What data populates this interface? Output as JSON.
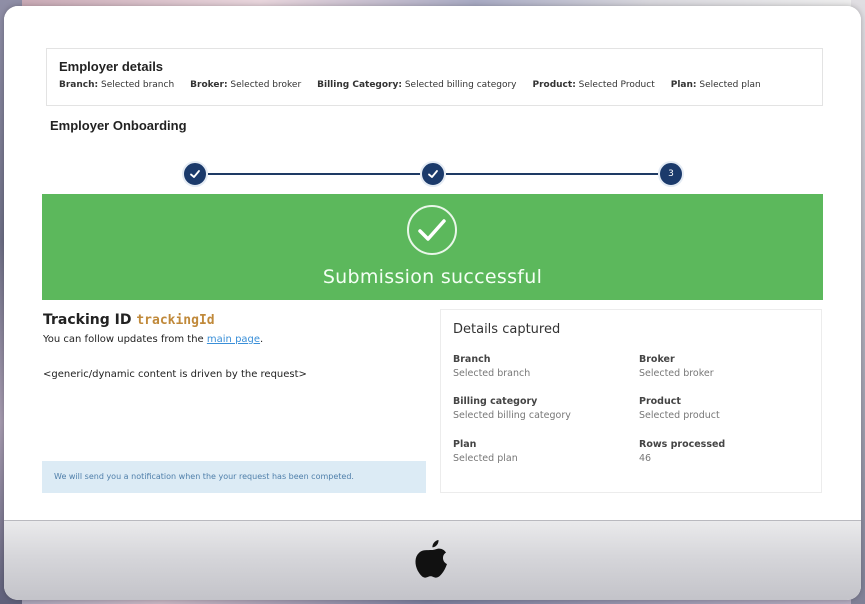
{
  "employer_details": {
    "title": "Employer details",
    "fields": [
      {
        "label": "Branch:",
        "value": "Selected branch"
      },
      {
        "label": "Broker:",
        "value": "Selected broker"
      },
      {
        "label": "Billing Category:",
        "value": "Selected billing category"
      },
      {
        "label": "Product:",
        "value": "Selected Product"
      },
      {
        "label": "Plan:",
        "value": "Selected plan"
      }
    ]
  },
  "onboarding": {
    "title": "Employer Onboarding",
    "steps": [
      {
        "state": "complete",
        "icon": "check-icon"
      },
      {
        "state": "complete",
        "icon": "check-icon"
      },
      {
        "state": "current",
        "number": "3"
      }
    ]
  },
  "banner": {
    "title": "Submission successful",
    "icon": "check-circle-icon",
    "color": "#5cb85c"
  },
  "tracking": {
    "label": "Tracking ID",
    "id": "trackingId",
    "follow_prefix": "You can follow updates from the",
    "follow_link": "main page",
    "follow_suffix": ".",
    "generic": "<generic/dynamic content is driven by the request>",
    "notice": "We will send you a notification when the your request has been competed."
  },
  "details_captured": {
    "title": "Details captured",
    "items": [
      {
        "label": "Branch",
        "value": "Selected branch"
      },
      {
        "label": "Broker",
        "value": "Selected broker"
      },
      {
        "label": "Billing category",
        "value": "Selected billing category"
      },
      {
        "label": "Product",
        "value": "Selected product"
      },
      {
        "label": "Plan",
        "value": "Selected plan"
      },
      {
        "label": "Rows processed",
        "value": "46"
      }
    ]
  },
  "device": {
    "logo": "apple-icon"
  }
}
